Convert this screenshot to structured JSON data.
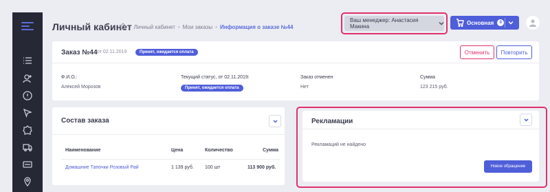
{
  "header": {
    "title": "Личный кабинет",
    "breadcrumbs": [
      "Личный кабинет",
      "Мои заказы",
      "Информация о заказе №44"
    ],
    "manager_label": "Ваш менеджер: Анастасия Макина",
    "main_button_label": "Основная",
    "cart_count": "0"
  },
  "order": {
    "title": "Заказ №44",
    "date": "от 02.11.2019",
    "status_badge": "Принят, ожидается оплата",
    "cancel_label": "Отменить",
    "repeat_label": "Повторить",
    "fields": {
      "fio_label": "Ф.И.О.:",
      "fio_value": "Алексей Морозов",
      "status_label": "Текущий статус, от 02.11.2019:",
      "status_value": "Принят, ожидается оплата",
      "cancelled_label": "Заказ отменен",
      "cancelled_value": "Нет",
      "sum_label": "Сумма",
      "sum_value": "123 215 руб."
    }
  },
  "composition": {
    "title": "Состав заказа",
    "columns": [
      "Наименование",
      "Цена",
      "Количество",
      "Сумма"
    ],
    "rows": [
      {
        "name": "Домашние Тапочки Розовый Рай",
        "price": "1 139 руб.",
        "qty": "100 шт",
        "sum": "113 900 руб."
      }
    ]
  },
  "reclamations": {
    "title": "Рекламации",
    "empty_text": "Рекламаций не найдено",
    "new_button_label": "Новое обращение"
  },
  "colors": {
    "accent": "#4f5ed9",
    "highlight": "#e0306a",
    "sidebar": "#262835",
    "background": "#ecedf3"
  },
  "icons": {
    "sidebar": [
      "menu-icon",
      "list-icon",
      "user-add-icon",
      "info-circle-icon",
      "cursor-icon",
      "badge-icon",
      "truck-icon",
      "visa-card-icon",
      "location-pin-icon"
    ],
    "header": [
      "home-icon",
      "chevron-down-icon",
      "cart-icon",
      "avatar-icon"
    ]
  }
}
